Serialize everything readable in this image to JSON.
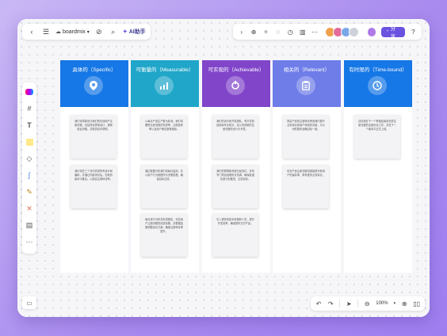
{
  "toolbar": {
    "brand": "boardmix",
    "ai_label": "AI助手",
    "share_label": "分享"
  },
  "zoom": "100%",
  "columns": [
    {
      "title": "具体的（Specific）",
      "color": "#1677e6",
      "icon": "location-pin-icon",
      "cards": [
        "我们将重新设计我们的在线用户注册流程，包括简化表单设计，更新验证流程，并提供实时帮助。",
        "我们将在三个月内完成所有设计和编码，并通过内部测试后，在新的版本中推出，以提高注册转化率。"
      ]
    },
    {
      "title": "可衡量的（Measurable）",
      "color": "#1fa6c9",
      "icon": "chart-icon",
      "cards": [
        "以每月产品生产数为标准，我们将跟踪注册流程的完成率，注册放弃率以及用户满意度等指标。",
        "通过数据分析我们将每月监测，并以用户行为数据作为决策依据，确保目标达成。",
        "每月进行分析并形成报告，评估用户注册流程的改进效果，并根据结果调整优化方案，确保注册转化率提升。"
      ]
    },
    {
      "title": "可实现的（Achievable）",
      "color": "#8045c9",
      "icon": "hand-icon",
      "cards": [
        "我们的设计和开发团队，有丰富的经验和专业知识，足以完成新的注册流程的设计与开发。",
        "我们的预算和资源已经到位，并有专门项目经理负责协调，确保各团队按计划推进，达成目标。",
        "引入更多的技术资源和人员，提升开发效率，确保按时交付产品。"
      ]
    },
    {
      "title": "相关的（Relevant）",
      "color": "#6e7de8",
      "icon": "clipboard-icon",
      "cards": [
        "提高产品的注册转化率是我们提升业务增长和用户体验的关键，与公司的整体战略目标一致。",
        "优化产品注册流程将直接提升新用户的留存率，带来更多业务增长。"
      ]
    },
    {
      "title": "有时限的（Time-bound）",
      "color": "#1677e6",
      "icon": "clock-icon",
      "cards": [
        "目标是在下一个季度结束前完成注册流程的全部优化工作，并在下一个版本中正式上线。"
      ]
    }
  ]
}
